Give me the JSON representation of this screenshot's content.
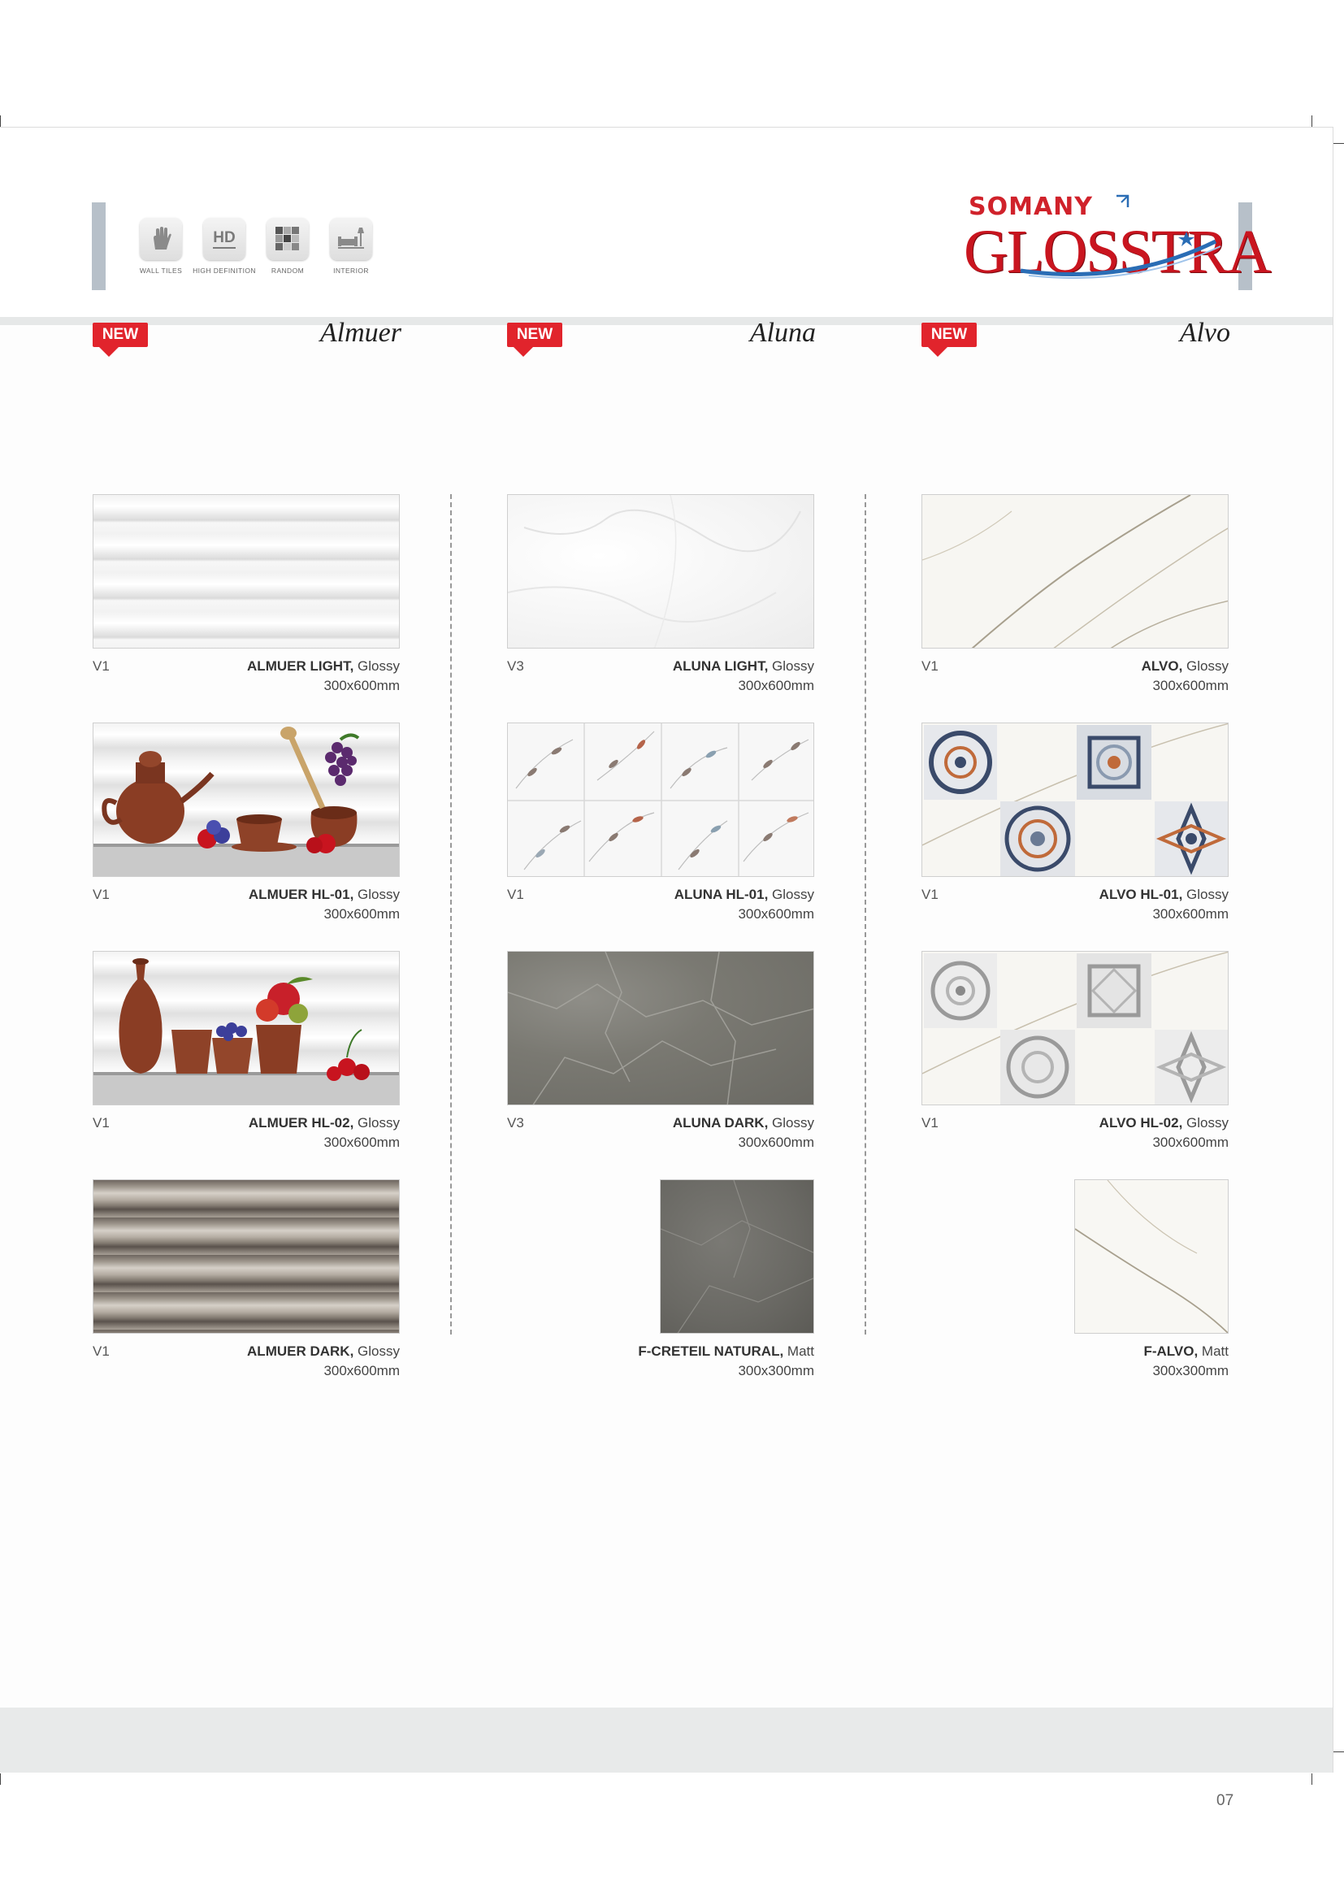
{
  "features": [
    {
      "icon": "hand-icon",
      "label": "WALL TILES"
    },
    {
      "icon": "hd-icon",
      "label": "HIGH DEFINITION"
    },
    {
      "icon": "random-grid-icon",
      "label": "RANDOM"
    },
    {
      "icon": "interior-icon",
      "label": "INTERIOR"
    }
  ],
  "hd_icon_text": "HD",
  "brand": {
    "top": "SOMANY",
    "name": "GLOSSTRA",
    "top_color": "#d0222b",
    "name_color": "#c9151f",
    "swoosh_color": "#2a6db5"
  },
  "columns": [
    {
      "badge": "NEW",
      "title": "Almuer",
      "items": [
        {
          "variant": "V1",
          "name": "ALMUER LIGHT,",
          "finish": " Glossy",
          "size": "300x600mm",
          "pattern": "almuer-light"
        },
        {
          "variant": "V1",
          "name": "ALMUER HL-01,",
          "finish": " Glossy",
          "size": "300x600mm",
          "pattern": "almuer-hl01"
        },
        {
          "variant": "V1",
          "name": "ALMUER HL-02,",
          "finish": " Glossy",
          "size": "300x600mm",
          "pattern": "almuer-hl02"
        },
        {
          "variant": "V1",
          "name": "ALMUER DARK,",
          "finish": " Glossy",
          "size": "300x600mm",
          "pattern": "almuer-dark"
        }
      ]
    },
    {
      "badge": "NEW",
      "title": "Aluna",
      "items": [
        {
          "variant": "V3",
          "name": "ALUNA LIGHT,",
          "finish": " Glossy",
          "size": "300x600mm",
          "pattern": "aluna-light"
        },
        {
          "variant": "V1",
          "name": "ALUNA HL-01,",
          "finish": " Glossy",
          "size": "300x600mm",
          "pattern": "aluna-hl01"
        },
        {
          "variant": "V3",
          "name": "ALUNA DARK,",
          "finish": " Glossy",
          "size": "300x600mm",
          "pattern": "aluna-dark"
        },
        {
          "variant": "",
          "name": "F-CRETEIL NATURAL,",
          "finish": " Matt",
          "size": "300x300mm",
          "pattern": "creteil"
        }
      ]
    },
    {
      "badge": "NEW",
      "title": "Alvo",
      "items": [
        {
          "variant": "V1",
          "name": "ALVO,",
          "finish": " Glossy",
          "size": "300x600mm",
          "pattern": "alvo"
        },
        {
          "variant": "V1",
          "name": "ALVO HL-01,",
          "finish": " Glossy",
          "size": "300x600mm",
          "pattern": "alvo-hl01"
        },
        {
          "variant": "V1",
          "name": "ALVO HL-02,",
          "finish": " Glossy",
          "size": "300x600mm",
          "pattern": "alvo-hl02"
        },
        {
          "variant": "",
          "name": "F-ALVO,",
          "finish": " Matt",
          "size": "300x300mm",
          "pattern": "f-alvo"
        }
      ]
    }
  ],
  "page_number": "07",
  "colors": {
    "badge": "#e1242c",
    "accent_bar": "#b7c0c9"
  }
}
